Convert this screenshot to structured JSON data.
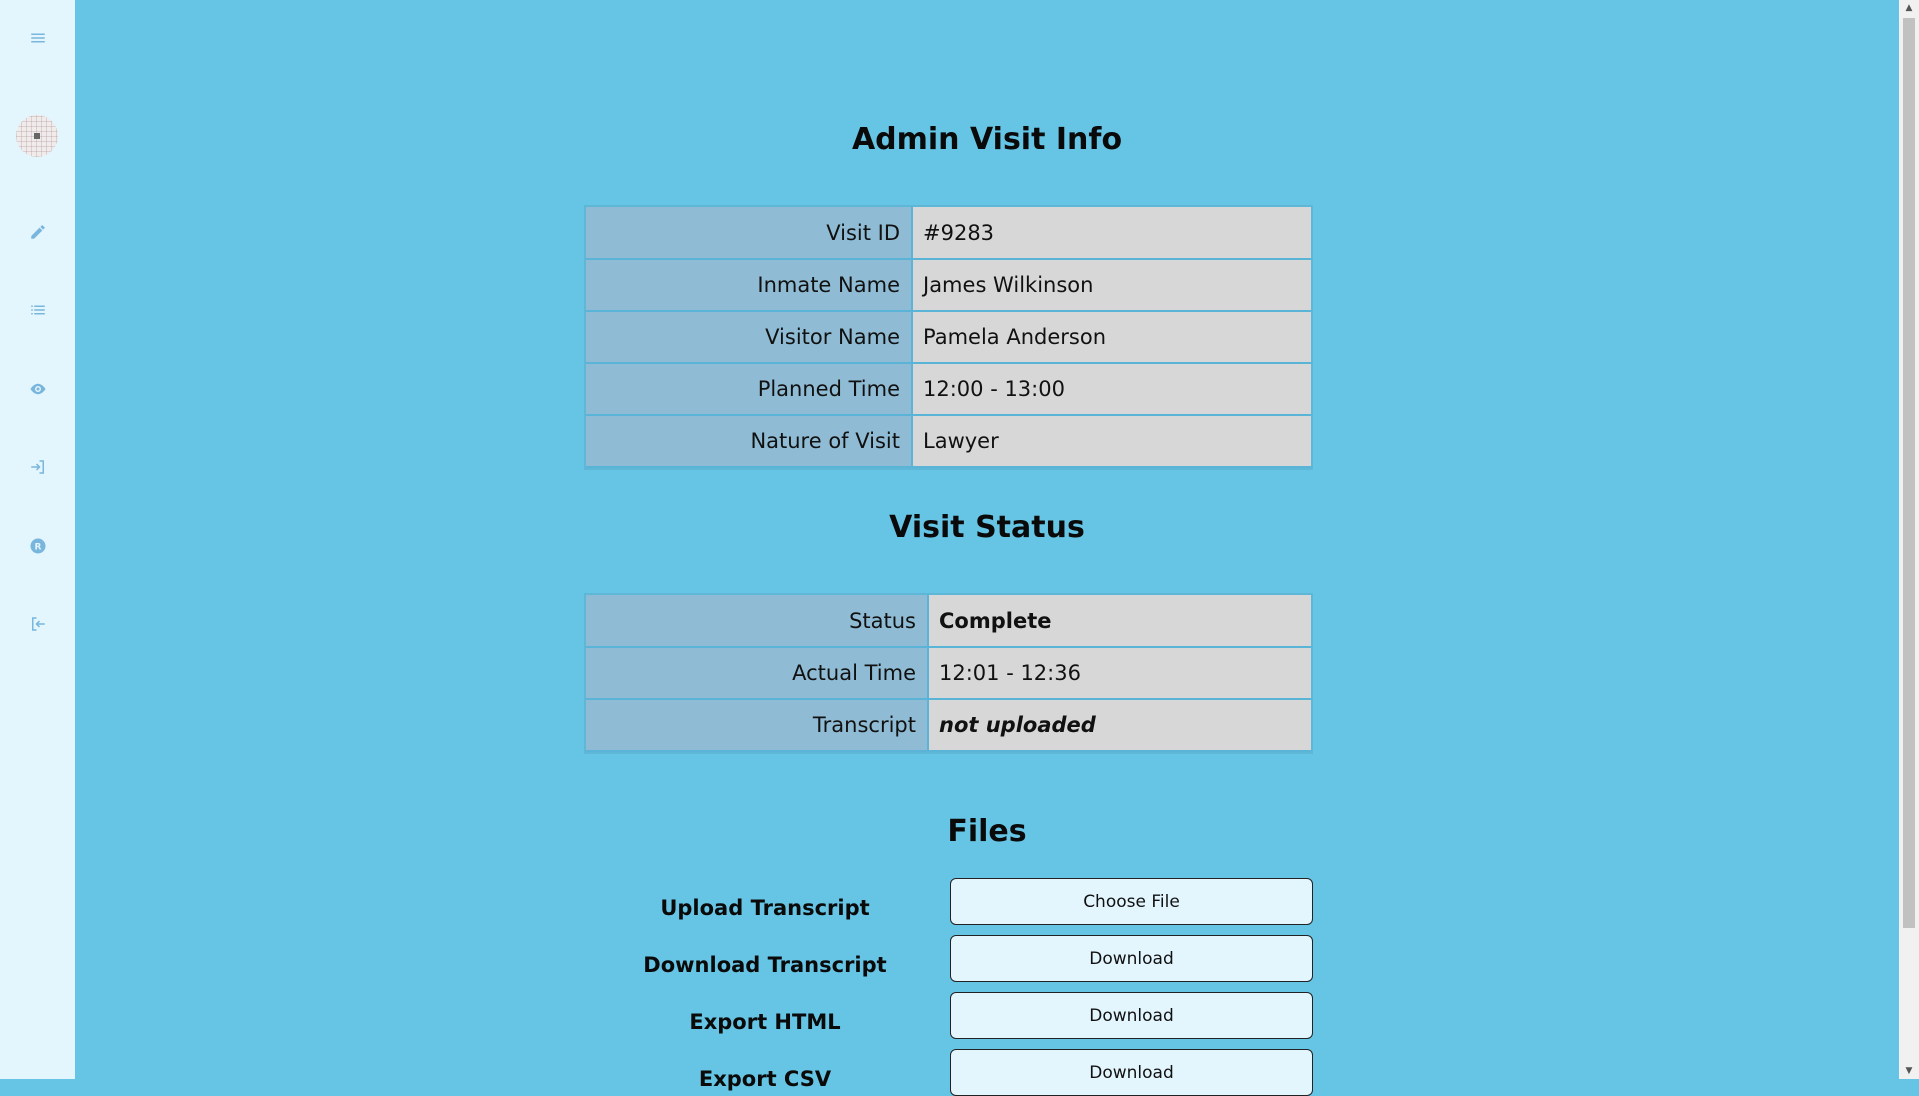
{
  "sidebar": {
    "icons": [
      "menu-icon",
      "edit-icon",
      "list-icon",
      "eye-icon",
      "login-icon",
      "r-circle-icon",
      "logout-icon"
    ]
  },
  "visit_info": {
    "title": "Admin Visit Info",
    "rows": [
      {
        "label": "Visit ID",
        "value": "#9283"
      },
      {
        "label": "Inmate Name",
        "value": "James Wilkinson"
      },
      {
        "label": "Visitor Name",
        "value": "Pamela Anderson"
      },
      {
        "label": "Planned Time",
        "value": "12:00 - 13:00"
      },
      {
        "label": "Nature of Visit",
        "value": "Lawyer"
      }
    ]
  },
  "visit_status": {
    "title": "Visit Status",
    "rows": [
      {
        "label": "Status",
        "value": "Complete"
      },
      {
        "label": "Actual Time",
        "value": "12:01 - 12:36"
      },
      {
        "label": "Transcript",
        "value": "not uploaded"
      }
    ]
  },
  "files": {
    "title": "Files",
    "items": [
      {
        "label": "Upload Transcript",
        "button": "Choose File"
      },
      {
        "label": "Download Transcript",
        "button": "Download"
      },
      {
        "label": "Export HTML",
        "button": "Download"
      },
      {
        "label": "Export CSV",
        "button": "Download"
      }
    ]
  },
  "colors": {
    "background": "#66c4e4",
    "sidebar": "#e3f5fd",
    "status_complete": "#128512",
    "status_missing": "#8a8a8a"
  }
}
